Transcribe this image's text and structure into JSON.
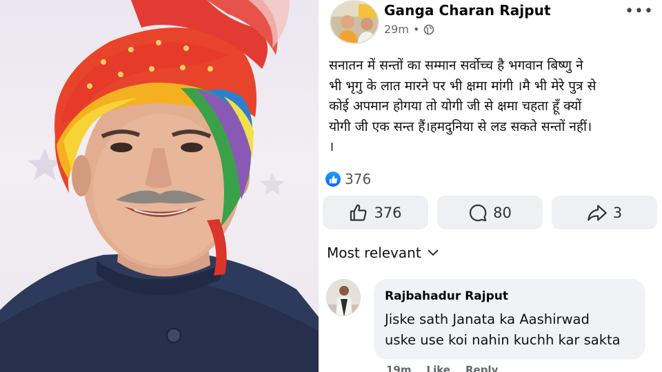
{
  "post": {
    "author_name": "Ganga Charan Rajput",
    "time": "29m",
    "separator": "•",
    "more_label": "•••",
    "text": "सनातन में  सन्तों  का  सम्मान सर्वोच्च है  भगवान बिष्णु ने\nभी भृगु के लात मारने पर भी क्षमा मांगी ।मै भी मेरे  पुत्र से\nकोई अपमान होगया तो योगी जी से  क्षमा  चहता हूँ क्यों\nयोगी जी  एक सन्त हैं।हमदुनिया से लड सकते सन्तों नहीं।\n।",
    "reaction_count": "376"
  },
  "actions": {
    "like_count": "376",
    "comment_count": "80",
    "share_count": "3"
  },
  "comments": {
    "sort_label": "Most relevant",
    "first": {
      "author": "Rajbahadur Rajput",
      "text": "Jiske sath Janata ka Aashirwad\nuske use koi nahin kuchh kar sakta",
      "time": "19m",
      "like_label": "Like",
      "reply_label": "Reply"
    }
  },
  "colors": {
    "facebook_blue": "#0866ff",
    "button_bg": "#eff0f3",
    "comment_bg": "#f0f2f5",
    "meta_gray": "#65676b"
  },
  "icons": {
    "globe": "globe-icon",
    "like": "thumbs-up-icon",
    "comment": "comment-bubble-icon",
    "share": "share-arrow-icon",
    "sort": "chevron-down-icon"
  }
}
